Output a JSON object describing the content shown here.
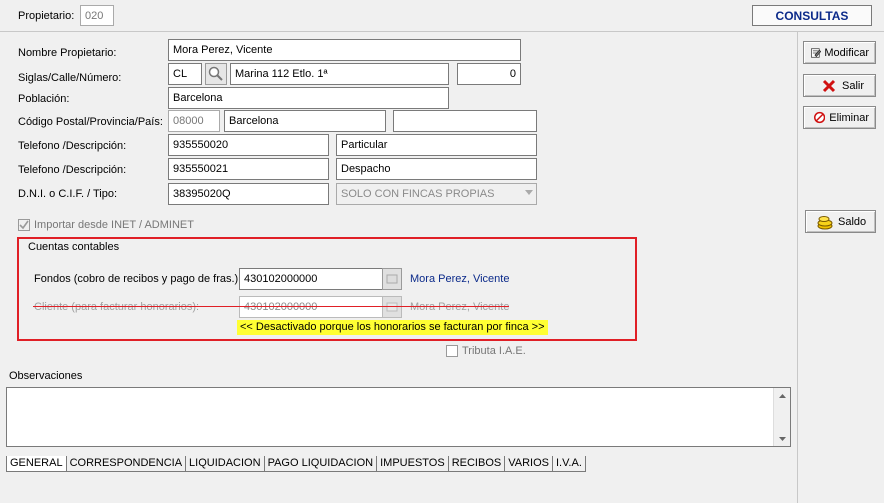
{
  "header": {
    "propietario_label": "Propietario:",
    "propietario_value": "020",
    "consultas_label": "CONSULTAS"
  },
  "form": {
    "nombre_label": "Nombre Propietario:",
    "nombre_value": "Mora Perez, Vicente",
    "siglas_label": "Siglas/Calle/Número:",
    "siglas_value": "CL",
    "calle_value": "Marina 112 Etlo. 1ª",
    "numero_value": "0",
    "poblacion_label": "Población:",
    "poblacion_value": "Barcelona",
    "cp_label": "Código Postal/Provincia/País:",
    "cp_value": "08000",
    "provincia_value": "Barcelona",
    "pais_value": "",
    "tel1_label": "Telefono /Descripción:",
    "tel1_value": "935550020",
    "tel1_desc": "Particular",
    "tel2_label": "Telefono /Descripción:",
    "tel2_value": "935550021",
    "tel2_desc": "Despacho",
    "dni_label": "D.N.I. o C.I.F. / Tipo:",
    "dni_value": "38395020Q",
    "tipo_value": "SOLO CON FINCAS PROPIAS",
    "importar_label": "Importar desde INET / ADMINET"
  },
  "cuentas": {
    "title": "Cuentas contables",
    "fondos_label": "Fondos (cobro de recibos y pago de fras.):",
    "fondos_value": "430102000000",
    "fondos_name": "Mora Perez, Vicente",
    "cliente_label": "Cliente (para facturar honorarios):",
    "cliente_value": "430102000000",
    "cliente_name": "Mora Perez, Vicente",
    "warning": "<< Desactivado porque los honorarios se facturan por finca >>"
  },
  "tributa_label": "Tributa I.A.E.",
  "observaciones_label": "Observaciones",
  "actions": {
    "modificar": "Modificar",
    "salir": "Salir",
    "eliminar": "Eliminar",
    "saldo": "Saldo"
  },
  "tabs": [
    "GENERAL",
    "CORRESPONDENCIA",
    "LIQUIDACION",
    "PAGO LIQUIDACION",
    "IMPUESTOS",
    "RECIBOS",
    "VARIOS",
    "I.V.A."
  ],
  "colors": {
    "accent_red": "#e01f26",
    "link_blue": "#0b2a8a",
    "warn_yellow": "#ffff33"
  }
}
